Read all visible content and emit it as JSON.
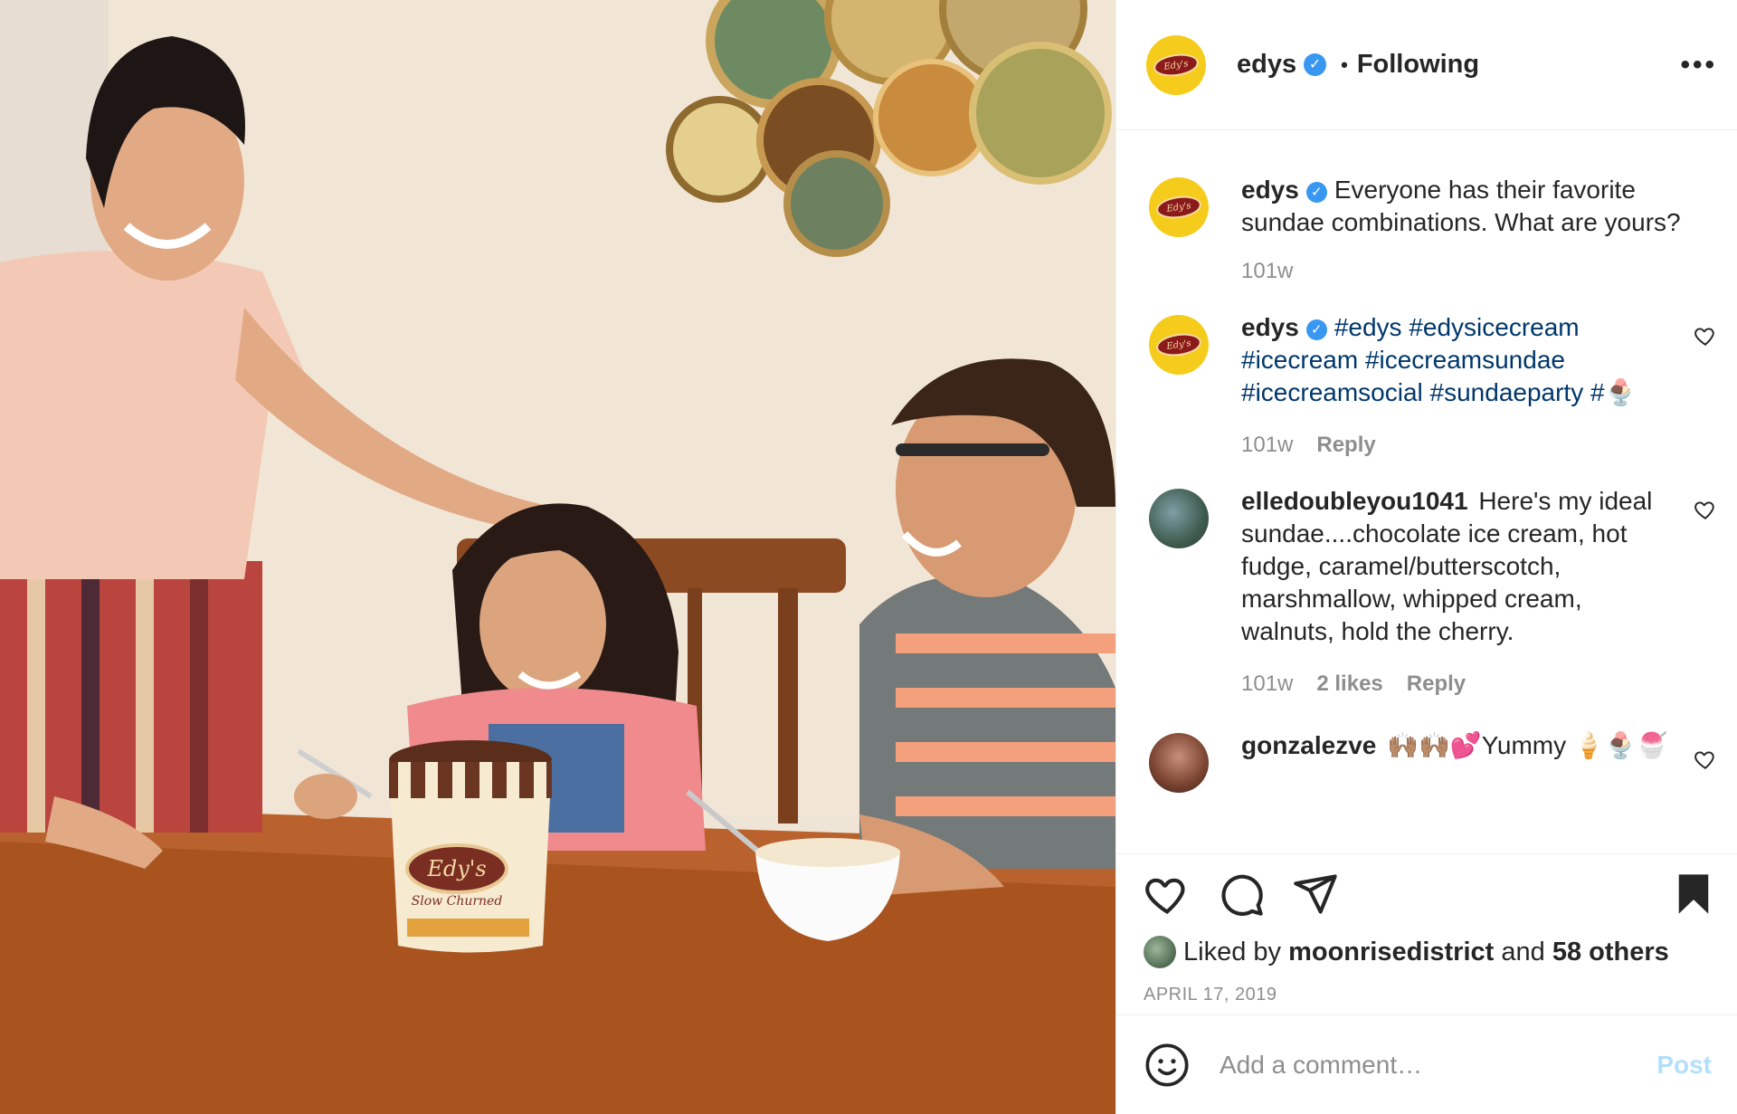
{
  "post": {
    "username": "edys",
    "verified_mark": "✓",
    "separator": "•",
    "follow_status": "Following",
    "more_icon": "more-horizontal-icon",
    "more_label": "•••",
    "photo_description_icon": "post-photo",
    "brand_logo_text": "Edy's",
    "carton_label": "Edy's",
    "carton_sub": "Slow Churned"
  },
  "comments": [
    {
      "username": "edys",
      "verified": true,
      "text": "Everyone has their favorite sundae combinations. What are yours?",
      "time": "101w"
    },
    {
      "username": "edys",
      "verified": true,
      "text": "#edys #edysicecream #icecream #icecreamsundae #icecreamsocial #sundaeparty #🍨",
      "time": "101w",
      "reply": "Reply"
    },
    {
      "username": "elledoubleyou1041",
      "text": "Here's my ideal sundae....chocolate ice cream, hot fudge, caramel/butterscotch, marshmallow, whipped cream, walnuts, hold the cherry.",
      "time": "101w",
      "likes": "2 likes",
      "reply": "Reply"
    },
    {
      "username": "gonzalezve",
      "text": "🙌🏽🙌🏽💕Yummy 🍦🍨🍧"
    }
  ],
  "actions": {
    "like_icon": "heart-icon",
    "comment_icon": "comment-icon",
    "share_icon": "paper-plane-icon",
    "save_icon": "bookmark-icon",
    "liked_by_prefix": "Liked by",
    "liked_by_user": "moonrisedistrict",
    "liked_by_and": "and",
    "liked_by_others": "58 others",
    "date": "APRIL 17, 2019"
  },
  "add_comment": {
    "emoji_icon": "smiley-icon",
    "placeholder": "Add a comment…",
    "post_label": "Post"
  },
  "colors": {
    "verified": "#3897f0",
    "hashtag": "#00376b",
    "meta": "#8e8e8e",
    "post_disabled": "#b2dffc",
    "brand_yellow": "#f5cc1c"
  }
}
